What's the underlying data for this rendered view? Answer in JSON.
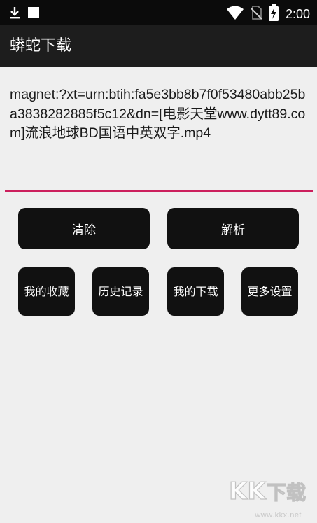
{
  "status_bar": {
    "time": "2:00",
    "icons": [
      "download-icon",
      "notification-square-icon",
      "wifi-icon",
      "no-sim-icon",
      "battery-charging-icon"
    ]
  },
  "app_bar": {
    "title": "蟒蛇下载"
  },
  "input": {
    "value": "magnet:?xt=urn:btih:fa5e3bb8b7f0f53480abb25ba3838282885f5c12&dn=[电影天堂www.dytt89.com]流浪地球BD国语中英双字.mp4",
    "underline_color": "#cc1f5d"
  },
  "actions": {
    "clear_label": "清除",
    "parse_label": "解析"
  },
  "menu": {
    "favorites_label": "我的收藏",
    "history_label": "历史记录",
    "downloads_label": "我的下载",
    "settings_label": "更多设置"
  },
  "watermark": {
    "logo_text": "KK下载",
    "url": "www.kkx.net"
  },
  "colors": {
    "accent": "#cc1f5d",
    "button_bg": "#111111",
    "app_bar_bg": "#1d1d1d",
    "status_bar_bg": "#0b0b0b",
    "page_bg": "#efefef"
  }
}
